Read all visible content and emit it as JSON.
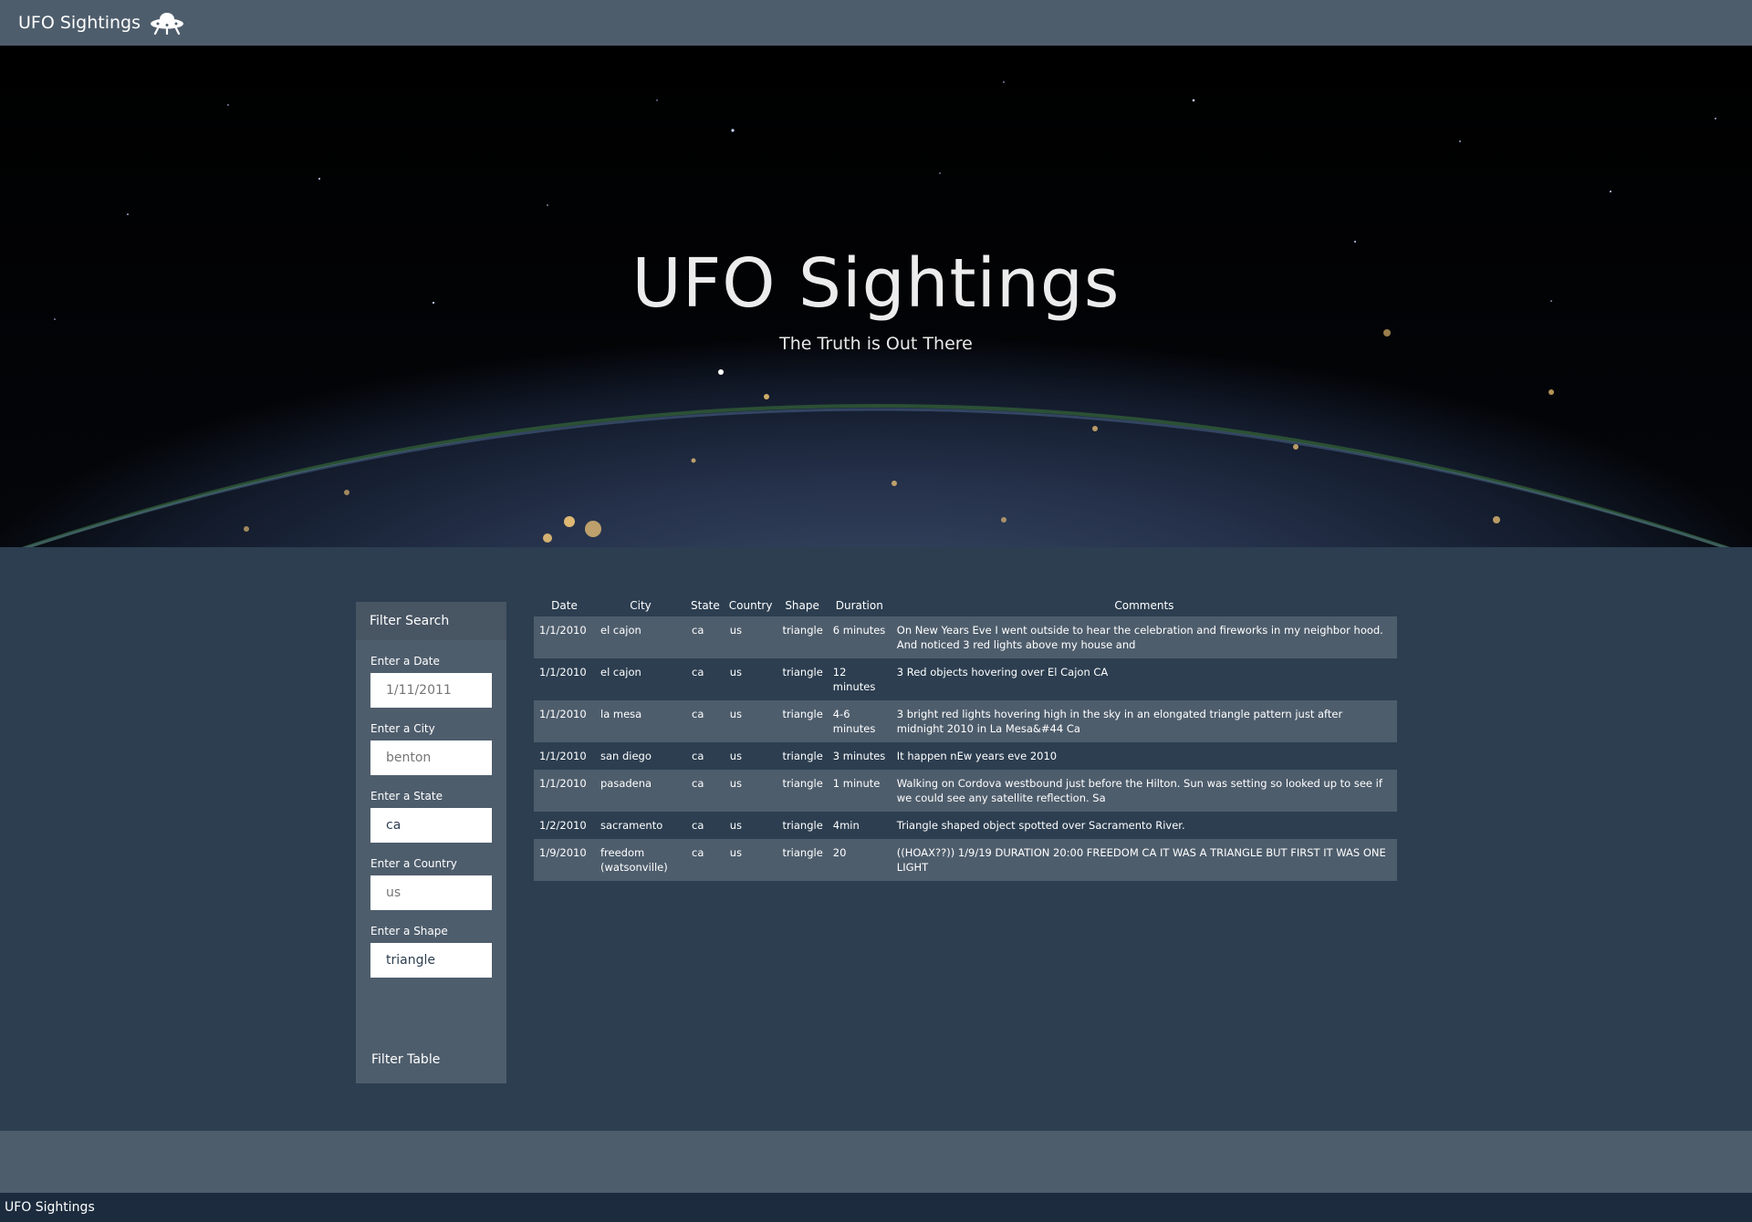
{
  "navbar": {
    "brand": "UFO Sightings",
    "brand_icon": "ufo-icon"
  },
  "hero": {
    "title": "UFO Sightings",
    "subtitle": "The Truth is Out There"
  },
  "filter": {
    "heading": "Filter Search",
    "fields": [
      {
        "label": "Enter a Date",
        "value": "",
        "placeholder": "1/11/2011"
      },
      {
        "label": "Enter a City",
        "value": "",
        "placeholder": "benton"
      },
      {
        "label": "Enter a State",
        "value": "ca",
        "placeholder": ""
      },
      {
        "label": "Enter a Country",
        "value": "",
        "placeholder": "us"
      },
      {
        "label": "Enter a Shape",
        "value": "triangle",
        "placeholder": ""
      }
    ],
    "button": "Filter Table"
  },
  "table": {
    "headers": [
      "Date",
      "City",
      "State",
      "Country",
      "Shape",
      "Duration",
      "Comments"
    ],
    "rows": [
      [
        "1/1/2010",
        "el cajon",
        "ca",
        "us",
        "triangle",
        "6 minutes",
        "On New Years Eve I went outside to hear the celebration and fireworks in my neighbor hood. And noticed 3 red lights above my house and"
      ],
      [
        "1/1/2010",
        "el cajon",
        "ca",
        "us",
        "triangle",
        "12 minutes",
        "3 Red objects hovering over El Cajon CA"
      ],
      [
        "1/1/2010",
        "la mesa",
        "ca",
        "us",
        "triangle",
        "4-6 minutes",
        "3 bright red lights hovering high in the sky in an elongated triangle pattern just after midnight 2010 in La Mesa&#44 Ca"
      ],
      [
        "1/1/2010",
        "san diego",
        "ca",
        "us",
        "triangle",
        "3 minutes",
        "It happen nEw years eve 2010"
      ],
      [
        "1/1/2010",
        "pasadena",
        "ca",
        "us",
        "triangle",
        "1 minute",
        "Walking on Cordova westbound just before the Hilton. Sun was setting so looked up to see if we could see any satellite reflection. Sa"
      ],
      [
        "1/2/2010",
        "sacramento",
        "ca",
        "us",
        "triangle",
        "4min",
        "Triangle shaped object spotted over Sacramento River."
      ],
      [
        "1/9/2010",
        "freedom (watsonville)",
        "ca",
        "us",
        "triangle",
        "20",
        "((HOAX??)) 1/9/19 DURATION 20:00 FREEDOM CA IT WAS A TRIANGLE BUT FIRST IT WAS ONE LIGHT"
      ]
    ]
  },
  "footer": {
    "text": "UFO Sightings"
  },
  "colors": {
    "navbar": "#4e5d6c",
    "body": "#2c3e50",
    "footer_bar": "#1c2c3e"
  }
}
